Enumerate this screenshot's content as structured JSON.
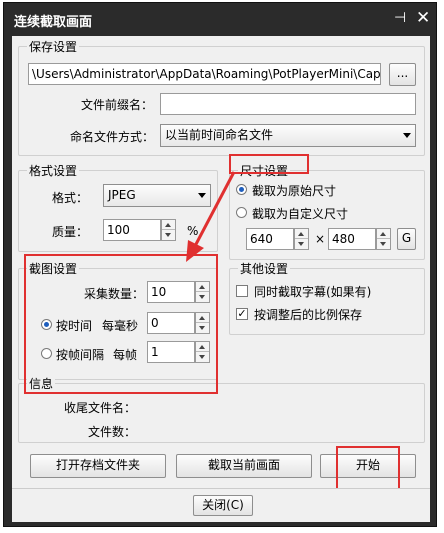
{
  "window": {
    "title": "连续截取画面",
    "pin_icon": "pin-icon",
    "close_icon": "close-icon"
  },
  "save": {
    "legend": "保存设置",
    "path": "\\Users\\Administrator\\AppData\\Roaming\\PotPlayerMini\\Capture",
    "browse_label": "...",
    "prefix_label": "文件前缀名：",
    "prefix_value": "",
    "naming_label": "命名文件方式：",
    "naming_value": "以当前时间命名文件"
  },
  "format": {
    "legend": "格式设置",
    "format_label": "格式：",
    "format_value": "JPEG",
    "quality_label": "质量：",
    "quality_value": "100",
    "quality_unit": "%"
  },
  "size": {
    "legend": "尺寸设置",
    "original_label": "截取为原始尺寸",
    "custom_label": "截取为自定义尺寸",
    "width_value": "640",
    "times": "×",
    "height_value": "480",
    "g_label": "G"
  },
  "capture": {
    "legend": "截图设置",
    "count_label": "采集数量：",
    "count_value": "10",
    "by_time_label": "按时间",
    "per_ms_label": "每毫秒",
    "ms_value": "0",
    "by_frame_label": "按帧间隔",
    "per_frame_label": "每帧",
    "frame_value": "1"
  },
  "other": {
    "legend": "其他设置",
    "subtitle_label": "同时截取字幕(如果有)",
    "aspect_label": "按调整后的比例保存"
  },
  "info": {
    "legend": "信息",
    "last_file_label": "收尾文件名：",
    "file_count_label": "文件数："
  },
  "actions": {
    "open_folder": "打开存档文件夹",
    "capture_current": "截取当前画面",
    "start": "开始",
    "close": "关闭(C)"
  },
  "colors": {
    "titlebar": "#2b2b2b",
    "highlight": "#e03030",
    "radio_selected": "#1e5ebd"
  }
}
